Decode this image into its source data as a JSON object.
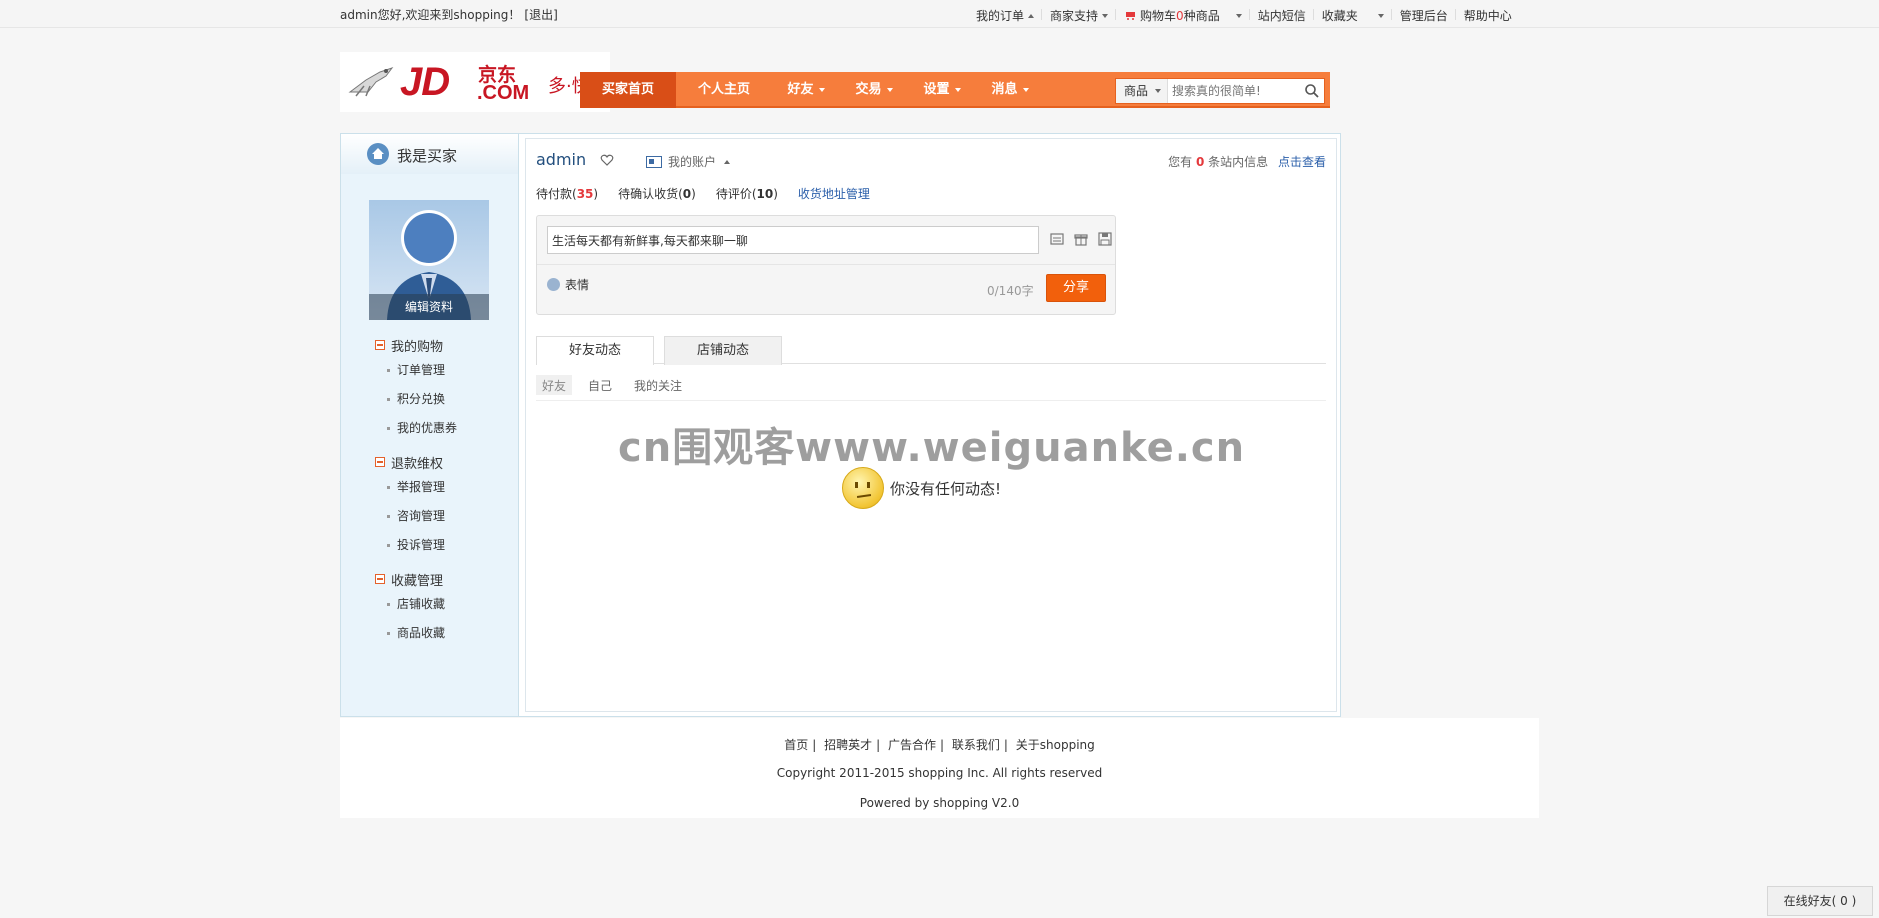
{
  "topbar": {
    "welcome": "admin您好,欢迎来到shopping！",
    "logout": "[退出]",
    "nav": {
      "my_orders": "我的订单",
      "merchant_support": "商家支持",
      "cart_prefix": "购物车",
      "cart_count": "0",
      "cart_suffix": "种商品",
      "site_messages": "站内短信",
      "favorites": "收藏夹",
      "admin_panel": "管理后台",
      "help_center": "帮助中心"
    }
  },
  "logo": {
    "jd": "JD",
    "cn": "京东",
    "com": ".COM",
    "slogan": "多·快·好"
  },
  "mainnav": {
    "items": [
      "买家首页",
      "个人主页",
      "好友",
      "交易",
      "设置",
      "消息"
    ],
    "search_category": "商品",
    "search_placeholder": "搜索真的很简单!"
  },
  "sidebar": {
    "title": "我是买家",
    "edit_profile": "编辑资料",
    "groups": [
      {
        "title": "我的购物",
        "items": [
          "订单管理",
          "积分兑换",
          "我的优惠券"
        ]
      },
      {
        "title": "退款维权",
        "items": [
          "举报管理",
          "咨询管理",
          "投诉管理"
        ]
      },
      {
        "title": "收藏管理",
        "items": [
          "店铺收藏",
          "商品收藏"
        ]
      }
    ]
  },
  "content": {
    "username": "admin",
    "my_account": "我的账户",
    "msg_prefix": "您有",
    "msg_count": "0",
    "msg_suffix": "条站内信息",
    "msg_link": "点击查看",
    "stats": {
      "pending_pay_label": "待付款(",
      "pending_pay": "35",
      "pending_receive_label": "待确认收货(",
      "pending_receive": "0",
      "pending_review_label": "待评价(",
      "pending_review": "10",
      "close": ")",
      "address_mgmt": "收货地址管理"
    },
    "share": {
      "input_value": "生活每天都有新鲜事,每天都来聊一聊",
      "emote": "表情",
      "counter": "0/140字",
      "button": "分享"
    },
    "tabs": [
      "好友动态",
      "店铺动态"
    ],
    "subtabs": [
      "好友",
      "自己",
      "我的关注"
    ],
    "watermark": "cn围观客www.weiguanke.cn",
    "empty_text": "你没有任何动态!"
  },
  "footer": {
    "links": [
      "首页",
      "招聘英才",
      "广告合作",
      "联系我们",
      "关于shopping"
    ],
    "separator": "|",
    "copyright": "Copyright 2011-2015 shopping Inc. All rights reserved",
    "powered": "Powered by shopping V2.0"
  },
  "online_friends": "在线好友( 0 )",
  "colors": {
    "accent_orange": "#f67d3c",
    "nav_active": "#d94e17",
    "brand_red": "#c81623",
    "share_button": "#f2600c"
  }
}
